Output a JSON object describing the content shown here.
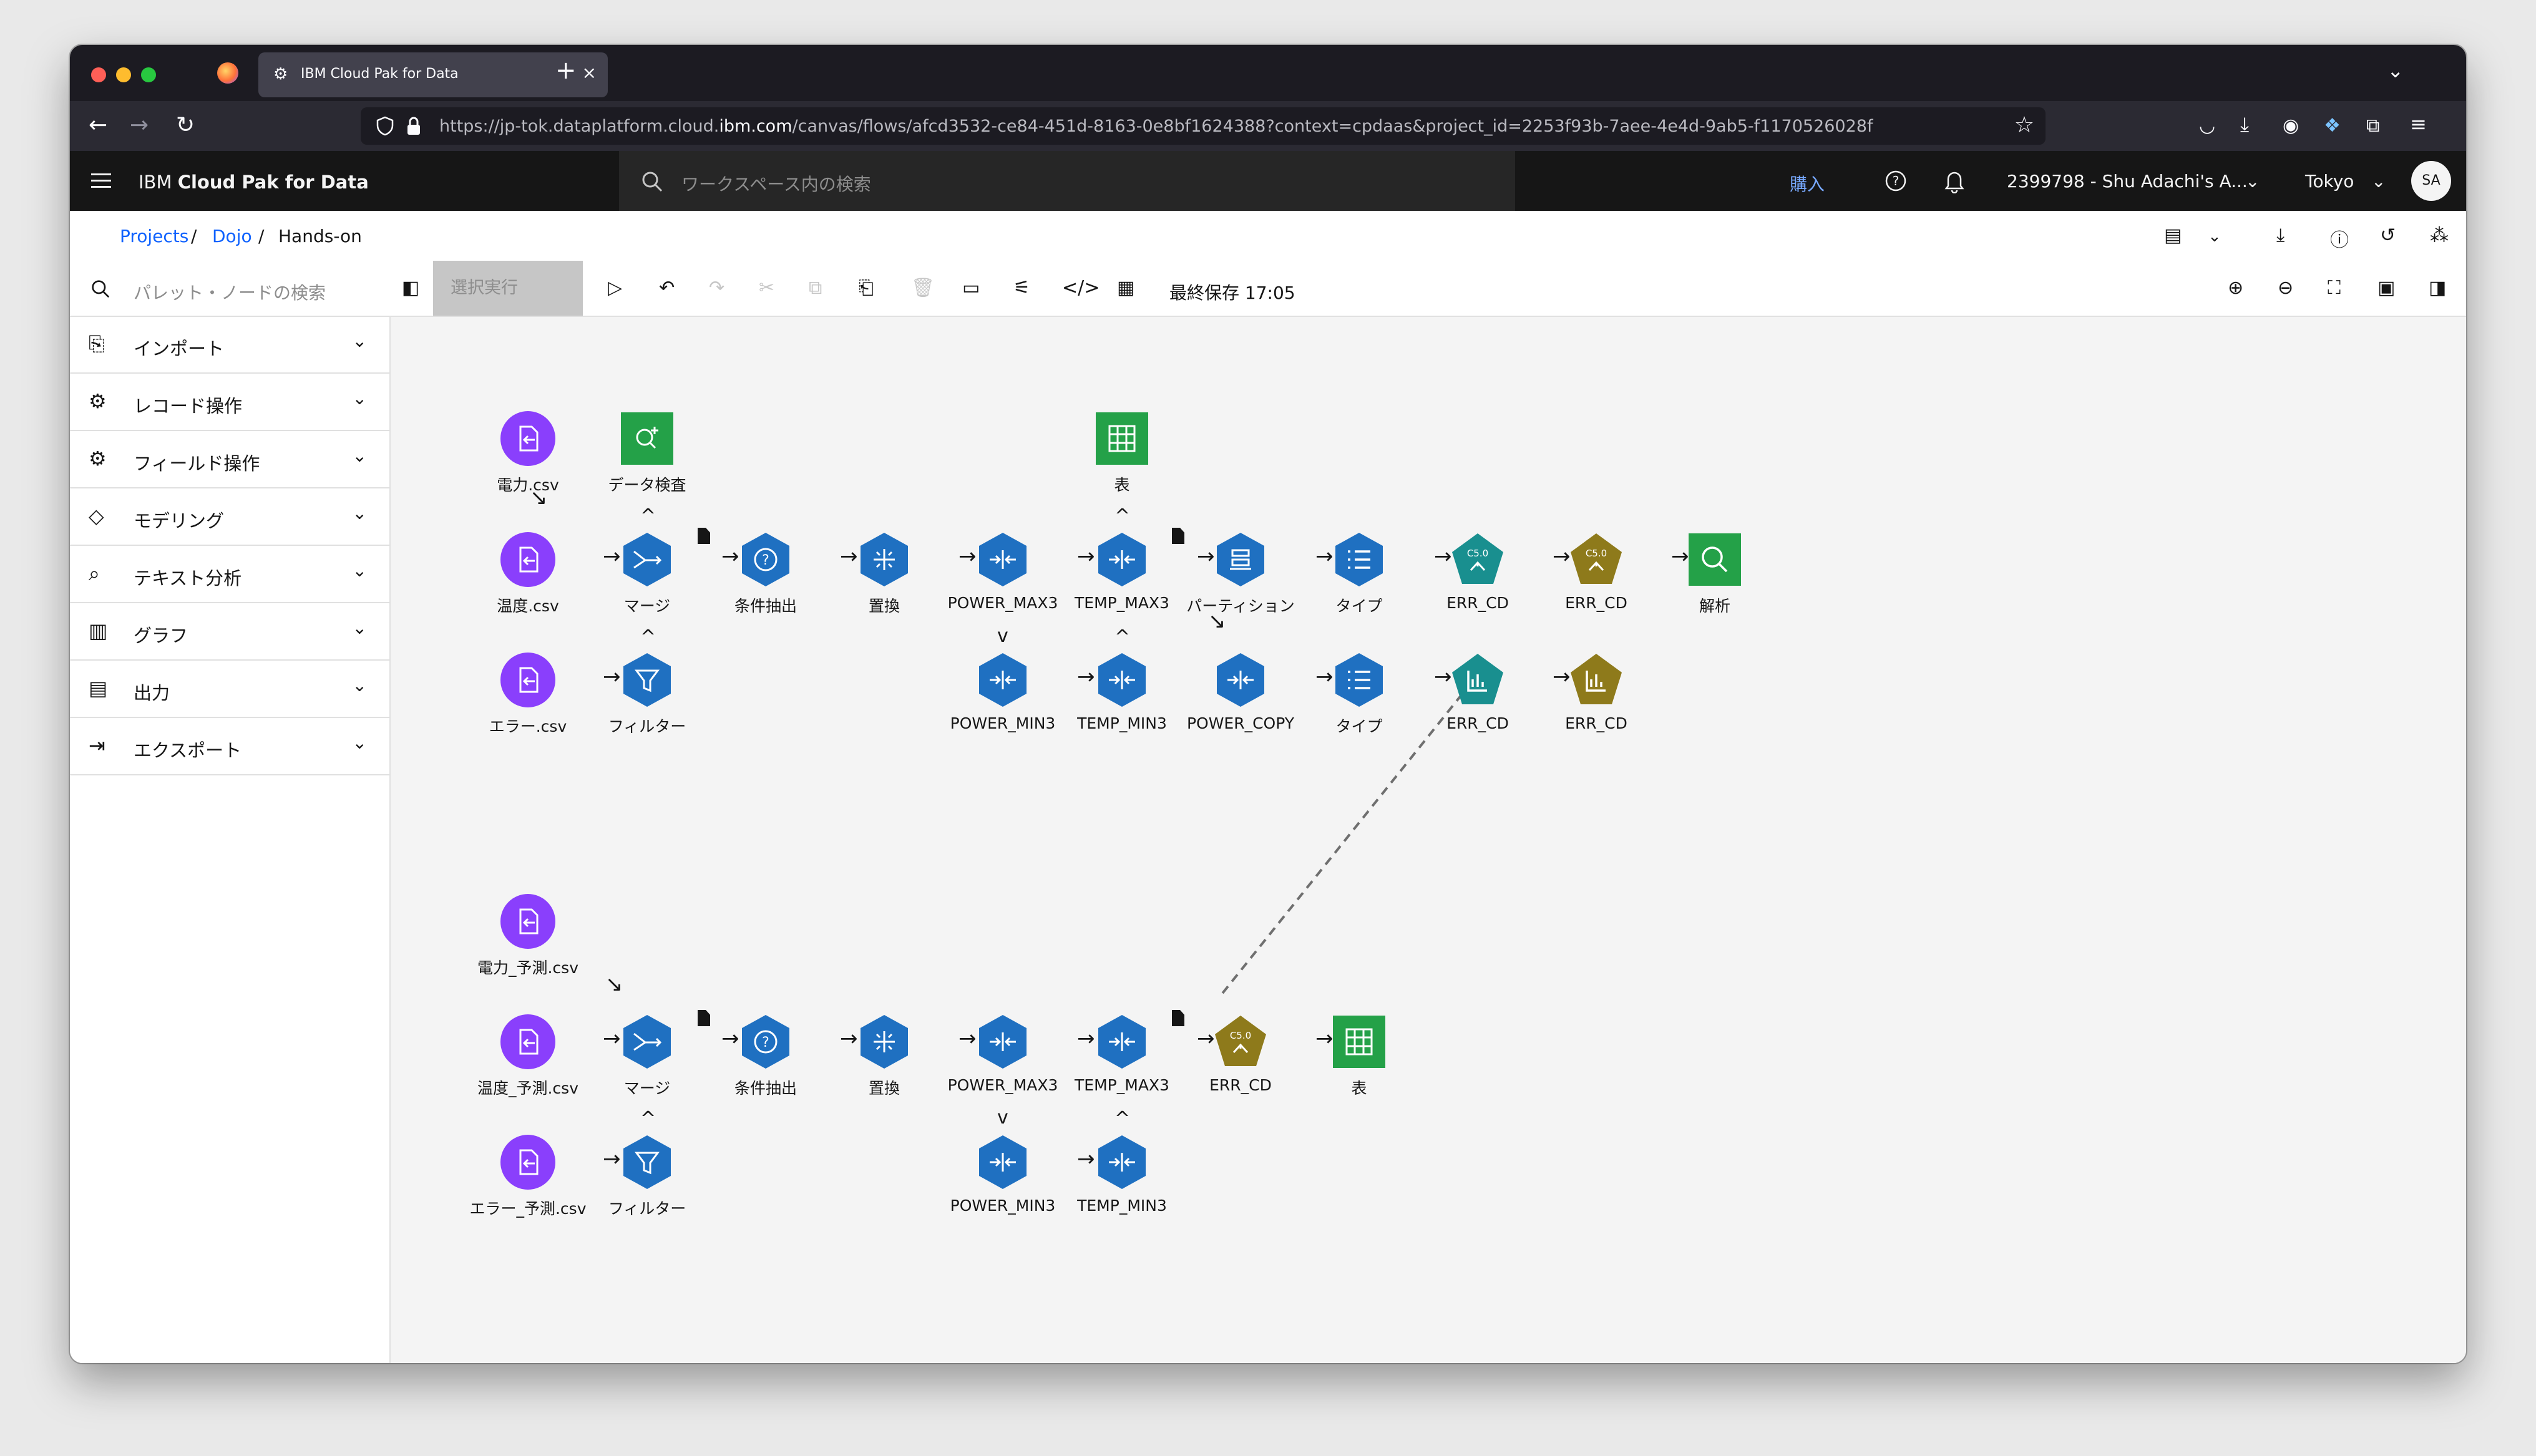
{
  "browser": {
    "tab_title": "IBM Cloud Pak for Data",
    "url_prefix": "https://jp-tok.dataplatform.cloud.",
    "url_domain": "ibm.com",
    "url_suffix": "/canvas/flows/afcd3532-ce84-451d-8163-0e8bf1624388?context=cpdaas&project_id=2253f93b-7aee-4e4d-9ab5-f1170526028f"
  },
  "header": {
    "title_regular": "IBM ",
    "title_bold": "Cloud Pak for Data",
    "search_placeholder": "ワークスペース内の検索",
    "buy": "購入",
    "account": "2399798 - Shu Adachi's A...",
    "region": "Tokyo",
    "avatar": "SA"
  },
  "breadcrumb": {
    "projects": "Projects",
    "dojo": "Dojo",
    "current": "Hands-on",
    "sep": "/"
  },
  "palette": {
    "search_placeholder": "パレット・ノードの検索",
    "items": [
      {
        "label": "インポート",
        "icon": "import-icon"
      },
      {
        "label": "レコード操作",
        "icon": "record-ops-icon"
      },
      {
        "label": "フィールド操作",
        "icon": "field-ops-icon"
      },
      {
        "label": "モデリング",
        "icon": "modeling-icon"
      },
      {
        "label": "テキスト分析",
        "icon": "text-analysis-icon"
      },
      {
        "label": "グラフ",
        "icon": "graph-icon"
      },
      {
        "label": "出力",
        "icon": "output-icon"
      },
      {
        "label": "エクスポート",
        "icon": "export-icon"
      }
    ]
  },
  "toolbar": {
    "run_selection": "選択実行",
    "last_saved": "最終保存 17:05"
  },
  "nodes": {
    "n_power": "電力.csv",
    "n_datacheck": "データ検査",
    "n_table_top": "表",
    "n_temp": "温度.csv",
    "n_merge1": "マージ",
    "n_select1": "条件抽出",
    "n_replace1": "置換",
    "n_powermax1": "POWER_MAX3",
    "n_tempmax1": "TEMP_MAX3",
    "n_partition": "パーティション",
    "n_type1": "タイプ",
    "n_errcd_model1": "ERR_CD",
    "n_errcd_nug1": "ERR_CD",
    "n_analysis": "解析",
    "n_error": "エラー.csv",
    "n_filter1": "フィルター",
    "n_powermin1": "POWER_MIN3",
    "n_tempmin1": "TEMP_MIN3",
    "n_powercopy": "POWER_COPY",
    "n_type2": "タイプ",
    "n_errcd_model2": "ERR_CD",
    "n_errcd_nug2": "ERR_CD",
    "n_power_pred": "電力_予測.csv",
    "n_temp_pred": "温度_予測.csv",
    "n_merge2": "マージ",
    "n_select2": "条件抽出",
    "n_replace2": "置換",
    "n_powermax2": "POWER_MAX3",
    "n_tempmax2": "TEMP_MAX3",
    "n_errcd_nug3": "ERR_CD",
    "n_table_bottom": "表",
    "n_error_pred": "エラー_予測.csv",
    "n_filter2": "フィルター",
    "n_powermin2": "POWER_MIN3",
    "n_tempmin2": "TEMP_MIN3"
  },
  "glyphs": {
    "c50": "C5.0",
    "arrow_right": "→",
    "arrow_up": "^",
    "arrow_down": "v",
    "arrow_diag": "↘"
  },
  "colors": {
    "source_purple": "#8a3ffc",
    "process_blue": "#1f70c1",
    "output_green": "#24a148",
    "model_teal": "#198f8f",
    "nugget_gold": "#8e7a1b",
    "link_blue": "#0f62fe"
  }
}
